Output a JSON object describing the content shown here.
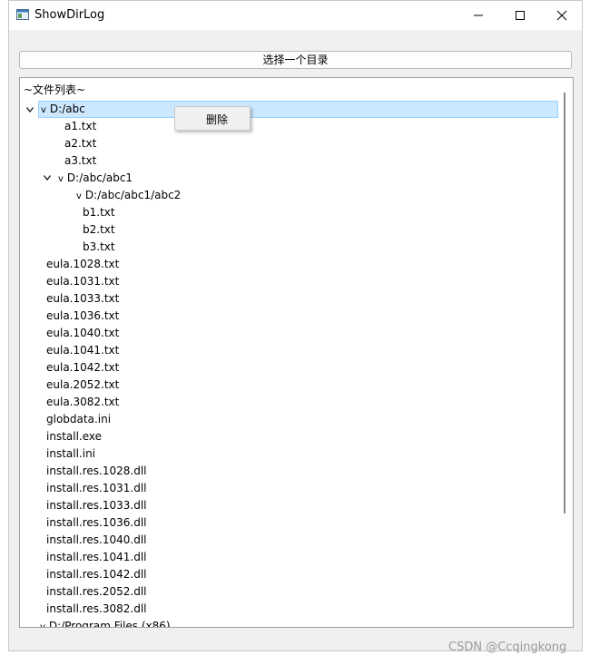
{
  "window": {
    "title": "ShowDirLog",
    "minimize_icon": "minimize-icon",
    "maximize_icon": "maximize-icon",
    "close_icon": "close-icon"
  },
  "toolbar": {
    "select_button_label": "选择一个目录"
  },
  "tree": {
    "header": "~文件列表~",
    "rows": [
      {
        "label": "D:/abc",
        "level": 0,
        "expanded": true,
        "selected": true,
        "is_dir": true
      },
      {
        "label": "a1.txt",
        "level": 1
      },
      {
        "label": "a2.txt",
        "level": 1
      },
      {
        "label": "a3.txt",
        "level": 1
      },
      {
        "label": "D:/abc/abc1",
        "level": 1,
        "expanded": true,
        "is_dir": true
      },
      {
        "label": "D:/abc/abc1/abc2",
        "level": 2,
        "is_dir": true
      },
      {
        "label": "b1.txt",
        "level": 2
      },
      {
        "label": "b2.txt",
        "level": 2
      },
      {
        "label": "b3.txt",
        "level": 2
      },
      {
        "label": "eula.1028.txt",
        "level": 0
      },
      {
        "label": "eula.1031.txt",
        "level": 0
      },
      {
        "label": "eula.1033.txt",
        "level": 0
      },
      {
        "label": "eula.1036.txt",
        "level": 0
      },
      {
        "label": "eula.1040.txt",
        "level": 0
      },
      {
        "label": "eula.1041.txt",
        "level": 0
      },
      {
        "label": "eula.1042.txt",
        "level": 0
      },
      {
        "label": "eula.2052.txt",
        "level": 0
      },
      {
        "label": "eula.3082.txt",
        "level": 0
      },
      {
        "label": "globdata.ini",
        "level": 0
      },
      {
        "label": "install.exe",
        "level": 0
      },
      {
        "label": "install.ini",
        "level": 0
      },
      {
        "label": "install.res.1028.dll",
        "level": 0
      },
      {
        "label": "install.res.1031.dll",
        "level": 0
      },
      {
        "label": "install.res.1033.dll",
        "level": 0
      },
      {
        "label": "install.res.1036.dll",
        "level": 0
      },
      {
        "label": "install.res.1040.dll",
        "level": 0
      },
      {
        "label": "install.res.1041.dll",
        "level": 0
      },
      {
        "label": "install.res.1042.dll",
        "level": 0
      },
      {
        "label": "install.res.2052.dll",
        "level": 0
      },
      {
        "label": "install.res.3082.dll",
        "level": 0
      },
      {
        "label": "D:/Program Files (x86)",
        "level": 0,
        "is_dir": true
      }
    ]
  },
  "context_menu": {
    "items": [
      "删除"
    ]
  },
  "watermark": "CSDN @Ccqingkong",
  "colors": {
    "selection": "#cce8ff",
    "selection_border": "#99d1ff",
    "window_bg": "#f0f0f0"
  }
}
